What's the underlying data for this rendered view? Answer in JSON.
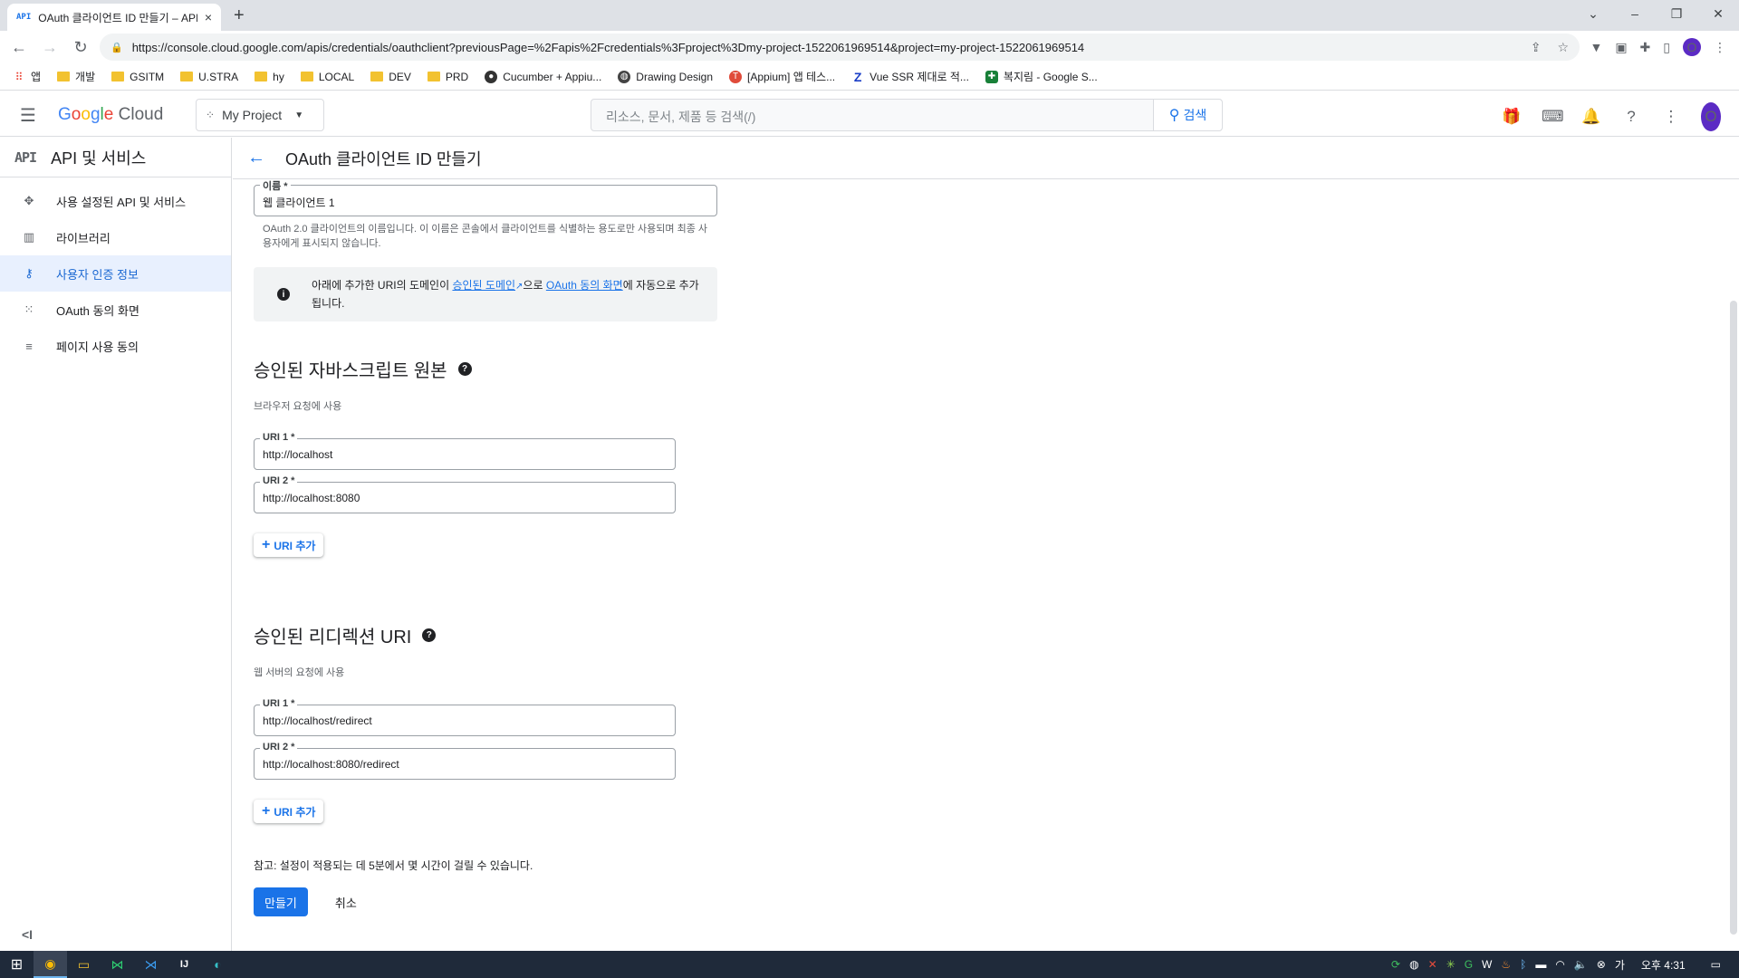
{
  "browser": {
    "tab_favicon": "API",
    "tab_title": "OAuth 클라이언트 ID 만들기 – API",
    "tab_close": "×",
    "new_tab": "+",
    "url": "https://console.cloud.google.com/apis/credentials/oauthclient?previousPage=%2Fapis%2Fcredentials%3Fproject%3Dmy-project-1522061969514&project=my-project-1522061969514",
    "profile_initial": "O"
  },
  "bookmarks": [
    {
      "label": "앱",
      "icon": "apps-grid-icon"
    },
    {
      "label": "개발",
      "icon": "folder-icon"
    },
    {
      "label": "GSITM",
      "icon": "folder-icon"
    },
    {
      "label": "U.STRA",
      "icon": "folder-icon"
    },
    {
      "label": "hy",
      "icon": "folder-icon"
    },
    {
      "label": "LOCAL",
      "icon": "folder-icon"
    },
    {
      "label": "DEV",
      "icon": "folder-icon"
    },
    {
      "label": "PRD",
      "icon": "folder-icon"
    },
    {
      "label": "Cucumber + Appiu...",
      "icon": "cucumber-icon"
    },
    {
      "label": "Drawing Design",
      "icon": "globe-icon"
    },
    {
      "label": "[Appium] 앱 테스...",
      "icon": "tistory-icon"
    },
    {
      "label": "Vue SSR 제대로 적...",
      "icon": "z-icon"
    },
    {
      "label": "복지림 - Google S...",
      "icon": "sheets-icon"
    }
  ],
  "header": {
    "logo_text": "Google Cloud",
    "project_name": "My Project",
    "search_placeholder": "리소스, 문서, 제품 등 검색(/)",
    "search_button": "검색",
    "avatar_initial": "O"
  },
  "sidebar": {
    "badge": "API",
    "title": "API 및 서비스",
    "items": [
      {
        "label": "사용 설정된 API 및 서비스",
        "icon": "api-hub-icon",
        "active": false
      },
      {
        "label": "라이브러리",
        "icon": "library-icon",
        "active": false
      },
      {
        "label": "사용자 인증 정보",
        "icon": "key-icon",
        "active": true
      },
      {
        "label": "OAuth 동의 화면",
        "icon": "consent-dots-icon",
        "active": false
      },
      {
        "label": "페이지 사용 동의",
        "icon": "settings-list-icon",
        "active": false
      }
    ],
    "collapse_glyph": "<I"
  },
  "page": {
    "title": "OAuth 클라이언트 ID 만들기",
    "name_field": {
      "label": "이름 *",
      "value": "웹 클라이언트 1"
    },
    "name_help": "OAuth 2.0 클라이언트의 이름입니다. 이 이름은 콘솔에서 클라이언트를 식별하는 용도로만 사용되며 최종 사용자에게 표시되지 않습니다.",
    "info": {
      "t1": "아래에 추가한 URI의 도메인이 ",
      "link1": "승인된 도메인",
      "t2": "으로 ",
      "link2": "OAuth 동의 화면",
      "t3": "에 자동으로 추가됩니다."
    },
    "js_origins": {
      "title": "승인된 자바스크립트 원본",
      "subtitle": "브라우저 요청에 사용",
      "uris": [
        {
          "label": "URI 1 *",
          "value": "http://localhost"
        },
        {
          "label": "URI 2 *",
          "value": "http://localhost:8080"
        }
      ],
      "add_label": "URI 추가"
    },
    "redirects": {
      "title": "승인된 리디렉션 URI",
      "subtitle": "웹 서버의 요청에 사용",
      "uris": [
        {
          "label": "URI 1 *",
          "value": "http://localhost/redirect"
        },
        {
          "label": "URI 2 *",
          "value": "http://localhost:8080/redirect"
        }
      ],
      "add_label": "URI 추가"
    },
    "note": "참고: 설정이 적용되는 데 5분에서 몇 시간이 걸릴 수 있습니다.",
    "create_button": "만들기",
    "cancel_button": "취소"
  },
  "taskbar": {
    "clock": "오후 4:31",
    "apps": [
      "windows-start-icon",
      "chrome-icon",
      "file-explorer-icon",
      "visual-studio-icon",
      "vscode-icon",
      "intellij-icon",
      "edge-icon"
    ]
  }
}
